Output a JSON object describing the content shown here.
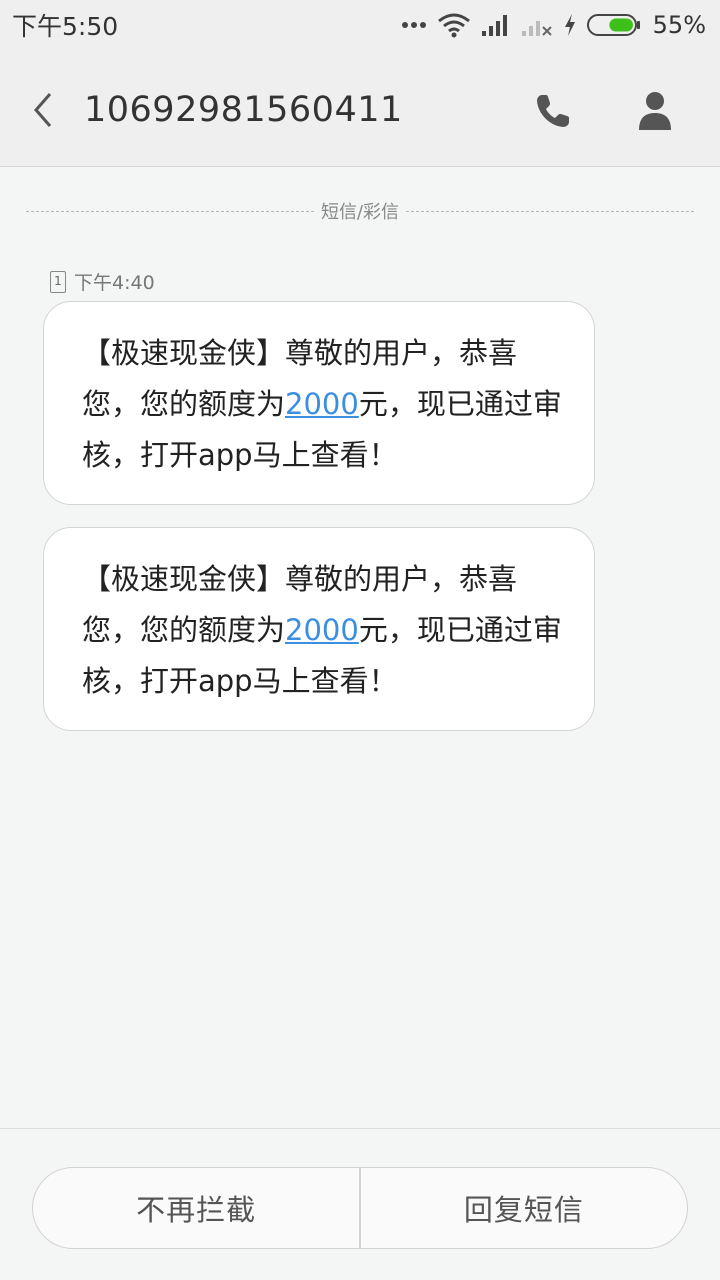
{
  "status_bar": {
    "time": "下午5:50",
    "battery_percent": "55%",
    "battery_level": 0.55,
    "icons": [
      "more-dots-icon",
      "wifi-icon",
      "signal-icon",
      "no-signal-icon",
      "charging-icon",
      "battery-icon"
    ]
  },
  "header": {
    "contact_number": "10692981560411",
    "icons": [
      "back-arrow-icon",
      "phone-icon",
      "person-icon"
    ]
  },
  "conversation": {
    "divider_label": "短信/彩信",
    "message_time": "下午4:40",
    "sim_slot": "1",
    "messages": [
      {
        "text_before": "【极速现金侠】尊敬的用户，恭喜您，您的额度为",
        "amount": "2000",
        "text_after": "元，现已通过审核，打开app马上查看！"
      },
      {
        "text_before": "【极速现金侠】尊敬的用户，恭喜您，您的额度为",
        "amount": "2000",
        "text_after": "元，现已通过审核，打开app马上查看！"
      }
    ]
  },
  "bottom_actions": {
    "unblock_label": "不再拦截",
    "reply_label": "回复短信"
  },
  "colors": {
    "accent_link": "#3c8ee0",
    "battery_green": "#3dc11a"
  }
}
